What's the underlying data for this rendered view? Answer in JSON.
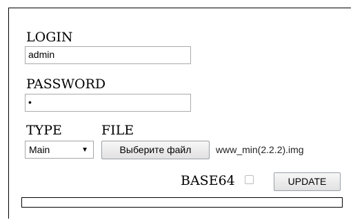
{
  "form": {
    "login_label": "LOGIN",
    "login_value": "admin",
    "password_label": "PASSWORD",
    "password_value": "•",
    "type_label": "TYPE",
    "file_label": "FILE",
    "type_selected": "Main",
    "file_button_label": "Выберите файл",
    "file_name": "www_min(2.2.2).img",
    "base64_label": "BASE64",
    "base64_checked": false,
    "update_label": "UPDATE"
  },
  "progress": {
    "fraction": 0
  }
}
